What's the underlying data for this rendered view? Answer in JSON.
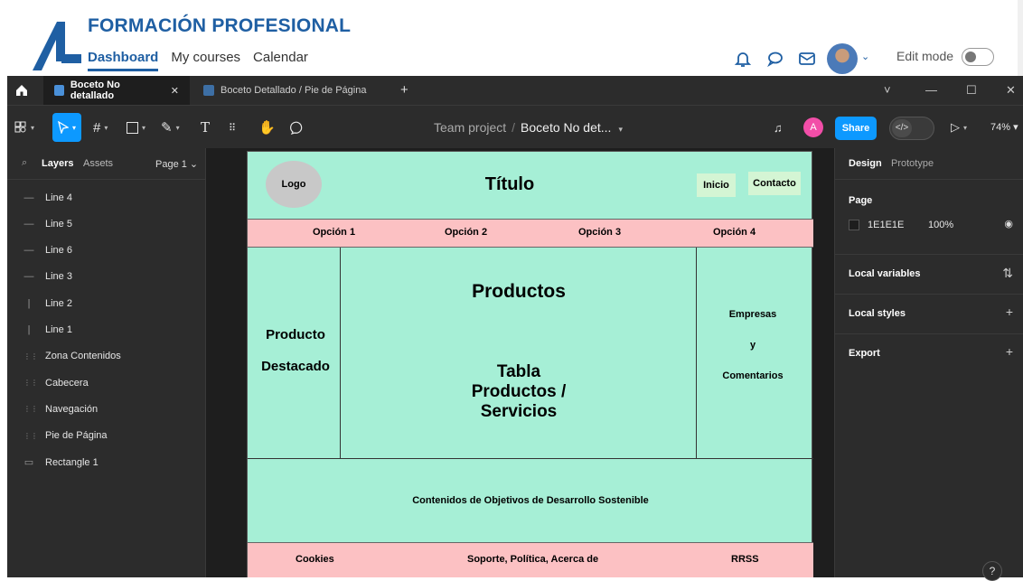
{
  "site": {
    "title": "FORMACIÓN PROFESIONAL",
    "nav": [
      "Dashboard",
      "My courses",
      "Calendar"
    ],
    "active_nav": "Dashboard",
    "edit_mode_label": "Edit mode",
    "edit_mode_on": false,
    "icons": [
      "bell-icon",
      "chat-icon",
      "mail-icon",
      "avatar",
      "chevron-down-icon"
    ]
  },
  "figma": {
    "tabs": [
      {
        "label": "Boceto No detallado",
        "active": true
      },
      {
        "label": "Boceto Detallado / Pie de Página",
        "active": false
      }
    ],
    "window_controls": [
      "˅",
      "—",
      "☐",
      "✕"
    ],
    "breadcrumb": {
      "project": "Team project",
      "file": "Boceto No det..."
    },
    "user_initial": "A",
    "share_label": "Share",
    "dev_mode_label": "</>",
    "zoom": "74%",
    "left_panel": {
      "tabs": [
        "Layers",
        "Assets"
      ],
      "page": "Page 1",
      "layers": [
        {
          "name": "Line 4",
          "icon": "line-h-icon"
        },
        {
          "name": "Line 5",
          "icon": "line-h-icon"
        },
        {
          "name": "Line 6",
          "icon": "line-h-icon"
        },
        {
          "name": "Line 3",
          "icon": "line-h-icon"
        },
        {
          "name": "Line 2",
          "icon": "line-v-icon"
        },
        {
          "name": "Line 1",
          "icon": "line-v-icon"
        },
        {
          "name": "Zona Contenidos",
          "icon": "group-icon"
        },
        {
          "name": "Cabecera",
          "icon": "group-icon"
        },
        {
          "name": "Navegación",
          "icon": "group-icon"
        },
        {
          "name": "Pie de Página",
          "icon": "group-icon"
        },
        {
          "name": "Rectangle 1",
          "icon": "rectangle-icon"
        }
      ]
    },
    "right_panel": {
      "tabs": [
        "Design",
        "Prototype"
      ],
      "page_label": "Page",
      "page_color": "1E1E1E",
      "page_opacity": "100%",
      "sections": [
        "Local variables",
        "Local styles",
        "Export"
      ]
    },
    "wireframe": {
      "logo": "Logo",
      "title": "Título",
      "header_buttons": [
        "Inicio",
        "Contacto"
      ],
      "nav": [
        "Opción 1",
        "Opción 2",
        "Opción 3",
        "Opción 4"
      ],
      "featured": [
        "Producto",
        "Destacado"
      ],
      "products_heading": "Productos",
      "table_lines": [
        "Tabla",
        "Productos /",
        "Servicios"
      ],
      "sidebar_lines": [
        "Empresas",
        "y",
        "Comentarios"
      ],
      "ods": "Contenidos de Objetivos de Desarrollo Sostenible",
      "footer": [
        "Cookies",
        "Soporte, Política, Acerca de",
        "RRSS"
      ]
    },
    "colors": {
      "frame_fill": "#a6efd6",
      "nav_fill": "#fcc1c3",
      "accent": "#0d99ff",
      "avatar_badge": "#f24ea8"
    },
    "help_label": "?"
  }
}
